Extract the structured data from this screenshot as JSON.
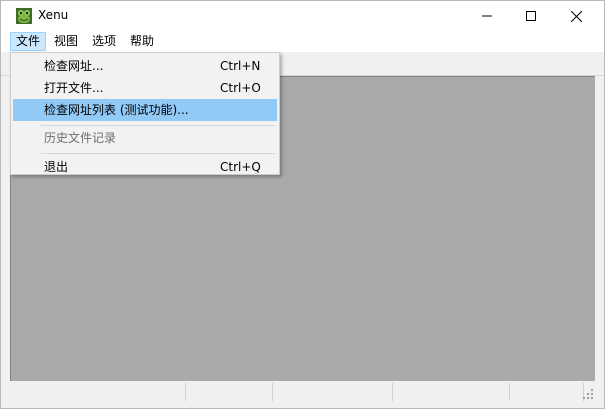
{
  "window": {
    "title": "Xenu",
    "app_icon": "xenu-frog-icon"
  },
  "controls": {
    "minimize": "minimize-icon",
    "maximize": "maximize-icon",
    "close": "close-icon"
  },
  "menubar": {
    "items": [
      {
        "label": "文件"
      },
      {
        "label": "视图"
      },
      {
        "label": "选项"
      },
      {
        "label": "帮助"
      }
    ]
  },
  "file_menu": {
    "items": [
      {
        "label": "检查网址...",
        "shortcut": "Ctrl+N"
      },
      {
        "label": "打开文件...",
        "shortcut": "Ctrl+O"
      },
      {
        "label": "检查网址列表 (测试功能)...",
        "shortcut": ""
      },
      {
        "label": "历史文件记录",
        "shortcut": ""
      },
      {
        "label": "退出",
        "shortcut": "Ctrl+Q"
      }
    ]
  },
  "colors": {
    "client_bg": "#a9a9a9",
    "highlight": "#91c9f7",
    "menu_active": "#cce8ff"
  }
}
